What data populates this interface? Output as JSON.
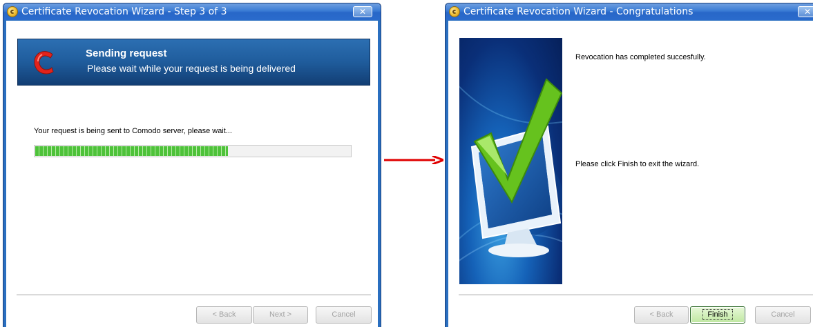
{
  "window1": {
    "title": "Certificate Revocation Wizard - Step 3 of 3",
    "close_label": "✕",
    "banner": {
      "title": "Sending request",
      "subtitle": "Please wait while your request is being delivered"
    },
    "status_message": "Your request is being sent to Comodo server, please wait...",
    "progress_fraction": 0.61,
    "buttons": {
      "back": "< Back",
      "next": "Next >",
      "cancel": "Cancel"
    }
  },
  "window2": {
    "title": "Certificate Revocation Wizard - Congratulations",
    "close_label": "✕",
    "completed_message": "Revocation has completed succesfully.",
    "finish_message": "Please click Finish to exit the wizard.",
    "buttons": {
      "back": "< Back",
      "finish": "Finish",
      "cancel": "Cancel"
    }
  },
  "colors": {
    "titlebar": "#2a6bcc",
    "banner": "#1f5c9c",
    "progress_green": "#4ec23a",
    "arrow": "#e00000"
  },
  "icons": [
    "app-icon",
    "close-icon",
    "comodo-logo",
    "checkmark-monitor-image",
    "arrow-right-icon"
  ]
}
